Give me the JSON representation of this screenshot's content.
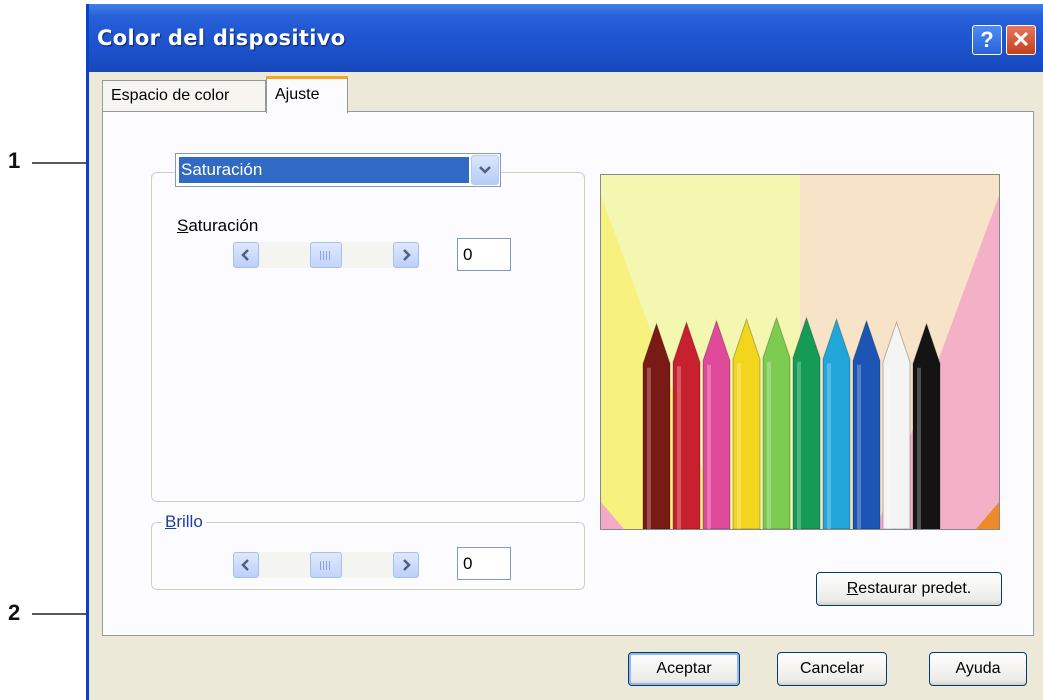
{
  "callouts": [
    "1",
    "2"
  ],
  "window": {
    "title": "Color del dispositivo",
    "help_button": "?",
    "close_button": "✕"
  },
  "tabs": [
    {
      "label": "Espacio de color",
      "active": false
    },
    {
      "label": "Ajuste",
      "active": true
    }
  ],
  "adjust": {
    "dropdown_value": "Saturación",
    "saturation": {
      "label_first": "S",
      "label_rest": "aturación",
      "value": "0",
      "level": 0.5
    },
    "brightness": {
      "label_first": "B",
      "label_rest": "rillo",
      "value": "0",
      "level": 0.5
    }
  },
  "preview_image": {
    "description_icon": "crayons-image",
    "crayon_colors": [
      "#7a1a17",
      "#c8202e",
      "#e04a9a",
      "#f2d51c",
      "#7ccc52",
      "#169b57",
      "#20a6d9",
      "#1c55b4",
      "#f4f4f4",
      "#141414"
    ],
    "ray_colors": [
      "#7fd0d9",
      "#f4a9c9",
      "#f7f27e",
      "#f3f7b0",
      "#f7e3c8",
      "#f3b0c6",
      "#ef8a2c",
      "#e63f2a"
    ]
  },
  "buttons": {
    "restore_first": "R",
    "restore_rest": "estaurar predet.",
    "accept": "Aceptar",
    "cancel": "Cancelar",
    "help": "Ayuda"
  },
  "colors": {
    "titlebar": "#1f55d0",
    "window_bg": "#ece9d8",
    "selection": "#316ac5",
    "tab_highlight": "#f5a623"
  }
}
